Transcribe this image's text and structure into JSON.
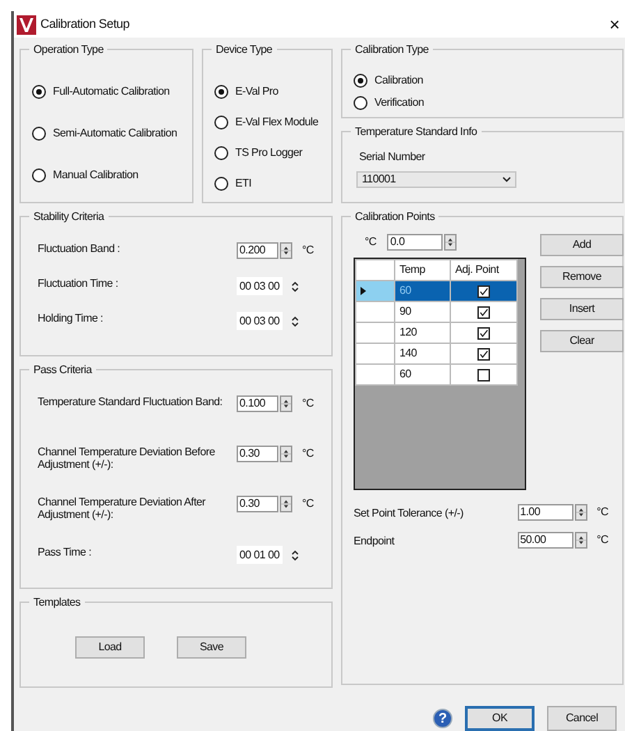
{
  "window": {
    "title": "Calibration Setup",
    "close": "×"
  },
  "operation_type": {
    "legend": "Operation Type",
    "options": [
      {
        "label": "Full-Automatic Calibration",
        "selected": true
      },
      {
        "label": "Semi-Automatic Calibration",
        "selected": false
      },
      {
        "label": "Manual Calibration",
        "selected": false
      }
    ]
  },
  "device_type": {
    "legend": "Device Type",
    "options": [
      {
        "label": "E-Val Pro",
        "selected": true
      },
      {
        "label": "E-Val Flex Module",
        "selected": false
      },
      {
        "label": "TS Pro Logger",
        "selected": false
      },
      {
        "label": "ETI",
        "selected": false
      }
    ]
  },
  "calibration_type": {
    "legend": "Calibration Type",
    "options": [
      {
        "label": "Calibration",
        "selected": true
      },
      {
        "label": "Verification",
        "selected": false
      }
    ]
  },
  "temperature_standard_info": {
    "legend": "Temperature Standard Info",
    "serial_label": "Serial Number",
    "serial_value": "110001"
  },
  "stability_criteria": {
    "legend": "Stability Criteria",
    "rows": [
      {
        "kind": "numeric",
        "label": "Fluctuation Band :",
        "value": "0.200",
        "unit": "°C"
      },
      {
        "kind": "time",
        "label": "Fluctuation Time :",
        "value": "00 03 00"
      },
      {
        "kind": "time",
        "label": "Holding Time :",
        "value": "00 03 00"
      }
    ]
  },
  "pass_criteria": {
    "legend": "Pass Criteria",
    "rows": [
      {
        "kind": "numeric",
        "label": "Temperature Standard Fluctuation Band:",
        "value": "0.100",
        "unit": "°C"
      },
      {
        "kind": "numeric",
        "label": "Channel Temperature Deviation Before Adjustment (+/-):",
        "value": "0.30",
        "unit": "°C"
      },
      {
        "kind": "numeric",
        "label": "Channel Temperature Deviation After Adjustment (+/-):",
        "value": "0.30",
        "unit": "°C"
      },
      {
        "kind": "time",
        "label": "Pass Time :",
        "value": "00 01 00"
      }
    ]
  },
  "templates": {
    "legend": "Templates",
    "buttons": [
      "Load",
      "Save"
    ]
  },
  "calibration_points": {
    "legend": "Calibration Points",
    "unit": "°C",
    "value": "0.0",
    "columns": [
      "Temp",
      "Adj. Point"
    ],
    "rows": [
      {
        "temp": "60",
        "adj_point": true,
        "selected": true
      },
      {
        "temp": "90",
        "adj_point": true,
        "selected": false
      },
      {
        "temp": "120",
        "adj_point": true,
        "selected": false
      },
      {
        "temp": "140",
        "adj_point": true,
        "selected": false
      },
      {
        "temp": "60",
        "adj_point": false,
        "selected": false
      }
    ],
    "buttons": [
      "Add",
      "Remove",
      "Insert",
      "Clear"
    ],
    "settings": [
      {
        "label": "Set Point Tolerance (+/-)",
        "value": "1.00",
        "unit": "°C"
      },
      {
        "label": "Endpoint",
        "value": "50.00",
        "unit": "°C"
      }
    ]
  },
  "footer": {
    "help": "?",
    "buttons": [
      {
        "label": "OK",
        "selected": true
      },
      {
        "label": "Cancel",
        "selected": false
      }
    ]
  }
}
